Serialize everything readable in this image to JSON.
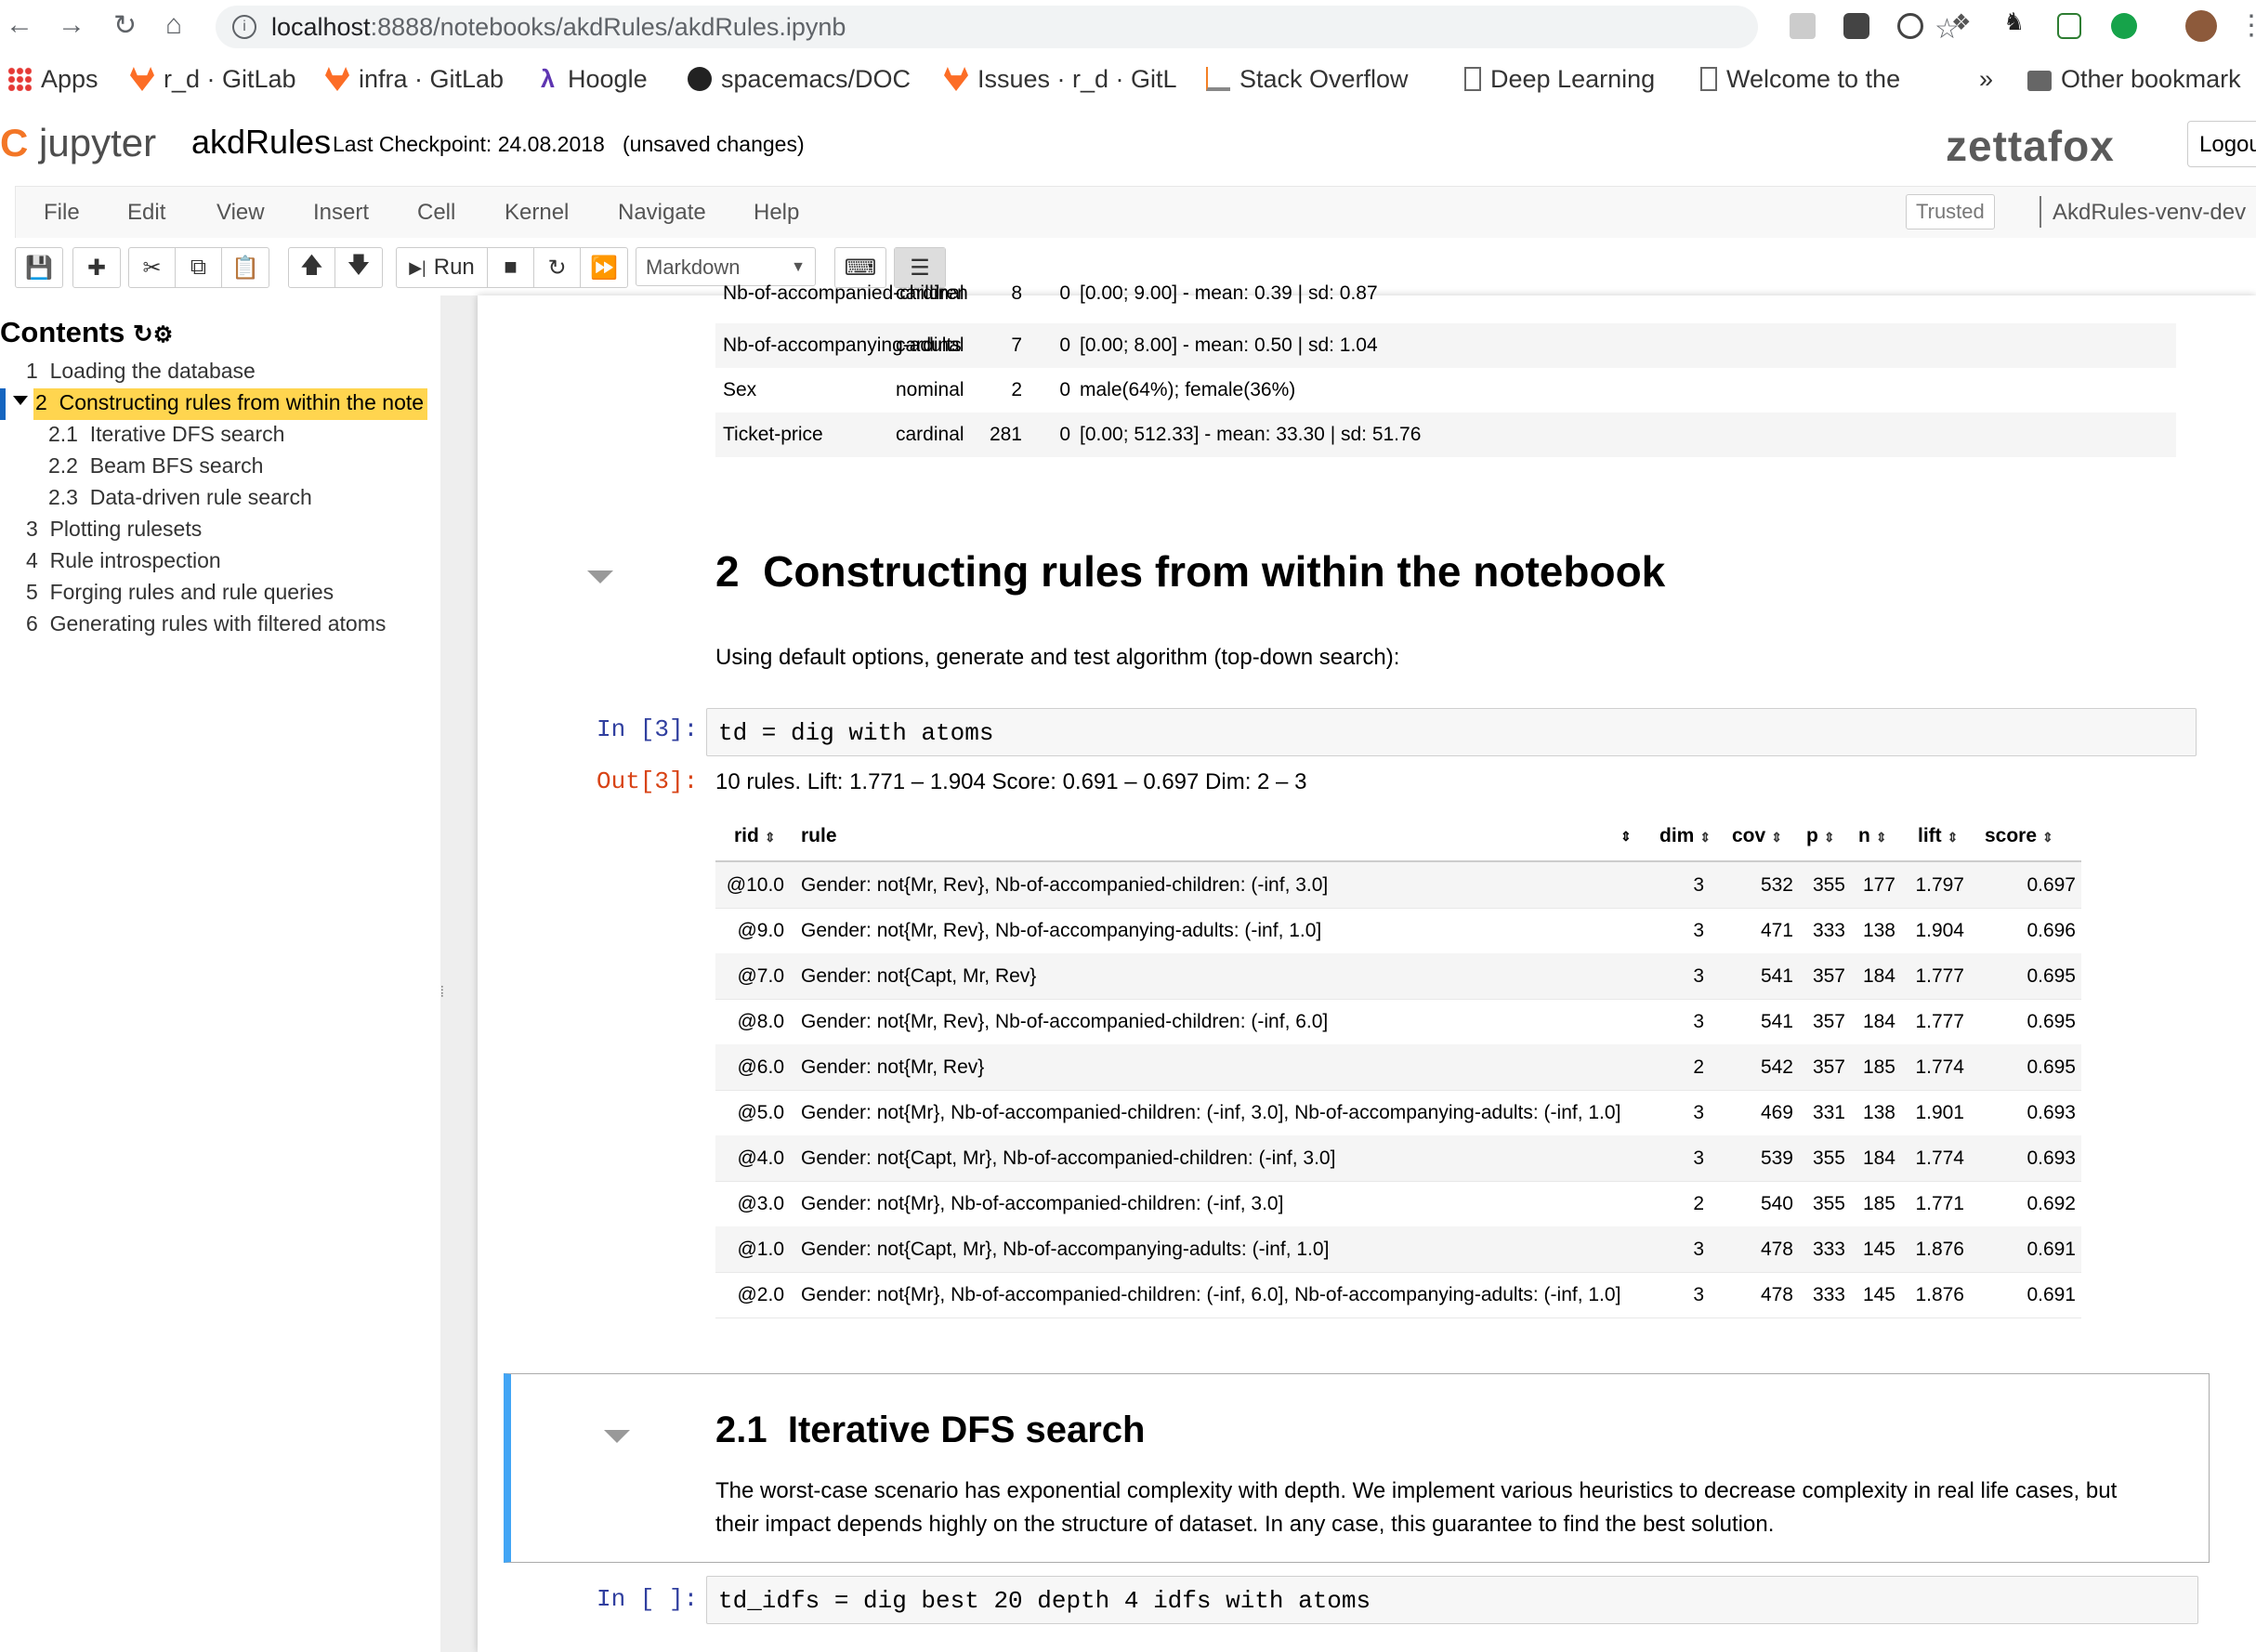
{
  "browser": {
    "url_host": "localhost",
    "url_path": ":8888/notebooks/akdRules/akdRules.ipynb",
    "bookmarks": [
      "Apps",
      "r_d · GitLab",
      "infra · GitLab",
      "Hoogle",
      "spacemacs/DOC",
      "Issues · r_d · GitL",
      "Stack Overflow",
      "Deep Learning",
      "Welcome to the",
      "»",
      "Other bookmark"
    ]
  },
  "jupyter": {
    "logo": "jupyter",
    "notebook_name": "akdRules",
    "checkpoint": "Last Checkpoint: 24.08.2018   (unsaved changes)",
    "brand": "zettafox",
    "logout": "Logou",
    "menu": [
      "File",
      "Edit",
      "View",
      "Insert",
      "Cell",
      "Kernel",
      "Navigate",
      "Help"
    ],
    "trusted": "Trusted",
    "kernel": "AkdRules-venv-dev",
    "run_label": "Run",
    "cell_type": "Markdown"
  },
  "toc": {
    "title": "Contents",
    "items": [
      {
        "num": "1",
        "label": "Loading the database"
      },
      {
        "num": "2",
        "label": "Constructing rules from within the note"
      },
      {
        "num": "2.1",
        "label": "Iterative DFS search"
      },
      {
        "num": "2.2",
        "label": "Beam BFS search"
      },
      {
        "num": "2.3",
        "label": "Data-driven rule search"
      },
      {
        "num": "3",
        "label": "Plotting rulesets"
      },
      {
        "num": "4",
        "label": "Rule introspection"
      },
      {
        "num": "5",
        "label": "Forging rules and rule queries"
      },
      {
        "num": "6",
        "label": "Generating rules with filtered atoms"
      }
    ]
  },
  "attributes_table": [
    {
      "name": "Nb-of-accompanied-children",
      "type": "cardinal",
      "n": "8",
      "missing": "0",
      "stats": "[0.00; 9.00] - mean: 0.39 | sd: 0.87"
    },
    {
      "name": "Nb-of-accompanying-adults",
      "type": "cardinal",
      "n": "7",
      "missing": "0",
      "stats": "[0.00; 8.00] - mean: 0.50 | sd: 1.04"
    },
    {
      "name": "Sex",
      "type": "nominal",
      "n": "2",
      "missing": "0",
      "stats": "male(64%); female(36%)"
    },
    {
      "name": "Ticket-price",
      "type": "cardinal",
      "n": "281",
      "missing": "0",
      "stats": "[0.00; 512.33] - mean: 33.30 | sd: 51.76"
    }
  ],
  "section2": {
    "heading_num": "2",
    "heading": "Constructing rules from within the notebook",
    "intro": "Using default options, generate and test algorithm (top-down search):",
    "in_prompt": "In [3]:",
    "code": "td = dig with atoms",
    "out_prompt": "Out[3]:",
    "summary": "10 rules. Lift: 1.771 – 1.904 Score: 0.691 – 0.697 Dim: 2 – 3"
  },
  "rules_table": {
    "headers": [
      "rid",
      "rule",
      "dim",
      "cov",
      "p",
      "n",
      "lift",
      "score"
    ],
    "rows": [
      [
        "@10.0",
        "Gender: not{Mr, Rev}, Nb-of-accompanied-children: (-inf, 3.0]",
        "3",
        "532",
        "355",
        "177",
        "1.797",
        "0.697"
      ],
      [
        "@9.0",
        "Gender: not{Mr, Rev}, Nb-of-accompanying-adults: (-inf, 1.0]",
        "3",
        "471",
        "333",
        "138",
        "1.904",
        "0.696"
      ],
      [
        "@7.0",
        "Gender: not{Capt, Mr, Rev}",
        "3",
        "541",
        "357",
        "184",
        "1.777",
        "0.695"
      ],
      [
        "@8.0",
        "Gender: not{Mr, Rev}, Nb-of-accompanied-children: (-inf, 6.0]",
        "3",
        "541",
        "357",
        "184",
        "1.777",
        "0.695"
      ],
      [
        "@6.0",
        "Gender: not{Mr, Rev}",
        "2",
        "542",
        "357",
        "185",
        "1.774",
        "0.695"
      ],
      [
        "@5.0",
        "Gender: not{Mr}, Nb-of-accompanied-children: (-inf, 3.0], Nb-of-accompanying-adults: (-inf, 1.0]",
        "3",
        "469",
        "331",
        "138",
        "1.901",
        "0.693"
      ],
      [
        "@4.0",
        "Gender: not{Capt, Mr}, Nb-of-accompanied-children: (-inf, 3.0]",
        "3",
        "539",
        "355",
        "184",
        "1.774",
        "0.693"
      ],
      [
        "@3.0",
        "Gender: not{Mr}, Nb-of-accompanied-children: (-inf, 3.0]",
        "2",
        "540",
        "355",
        "185",
        "1.771",
        "0.692"
      ],
      [
        "@1.0",
        "Gender: not{Capt, Mr}, Nb-of-accompanying-adults: (-inf, 1.0]",
        "3",
        "478",
        "333",
        "145",
        "1.876",
        "0.691"
      ],
      [
        "@2.0",
        "Gender: not{Mr}, Nb-of-accompanied-children: (-inf, 6.0], Nb-of-accompanying-adults: (-inf, 1.0]",
        "3",
        "478",
        "333",
        "145",
        "1.876",
        "0.691"
      ]
    ]
  },
  "section21": {
    "heading_num": "2.1",
    "heading": "Iterative DFS search",
    "para1": "The worst-case scenario has exponential complexity with depth. We implement various heuristics to decrease complexity in real life cases, but",
    "para2": "their impact depends highly on the structure of dataset. In any case, this guarantee to find the best solution.",
    "in_prompt": "In [ ]:",
    "code": "td_idfs = dig best 20 depth 4 idfs with atoms"
  }
}
